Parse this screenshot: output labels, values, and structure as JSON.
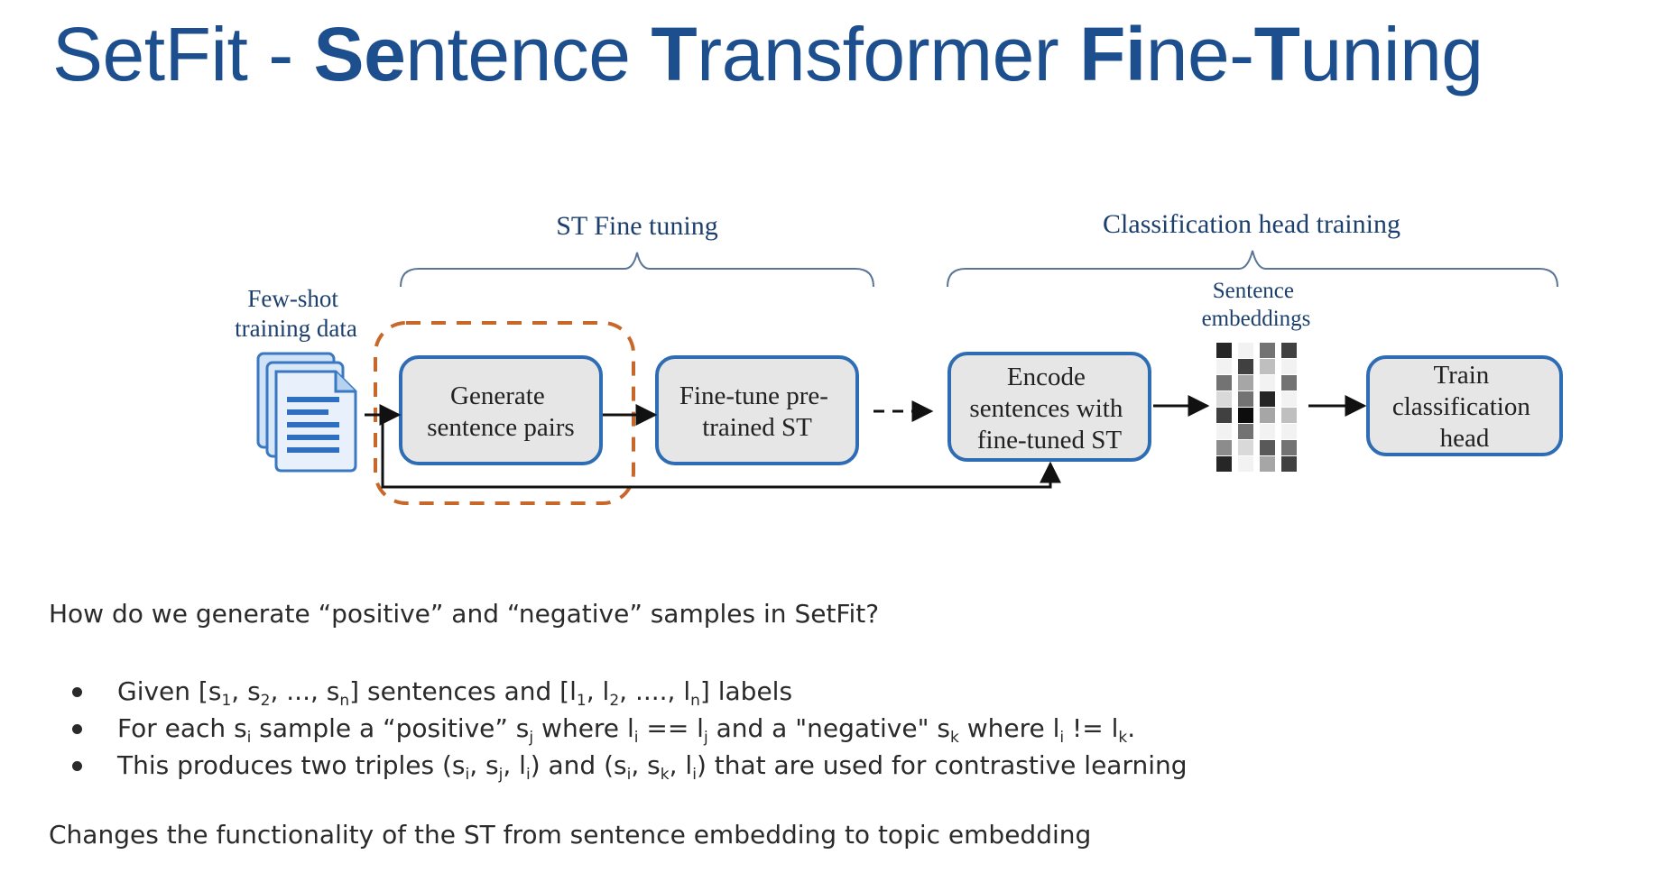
{
  "slide": {
    "title_parts": [
      {
        "t": "SetFit - ",
        "b": false
      },
      {
        "t": "Se",
        "b": true
      },
      {
        "t": "ntence ",
        "b": false
      },
      {
        "t": "T",
        "b": true
      },
      {
        "t": "ransformer ",
        "b": false
      },
      {
        "t": "Fi",
        "b": true
      },
      {
        "t": "ne-",
        "b": false
      },
      {
        "t": "T",
        "b": true
      },
      {
        "t": "uning",
        "b": false
      }
    ]
  },
  "diagram": {
    "stage_labels": {
      "st_fine_tuning": "ST Fine tuning",
      "classification_head_training": "Classification head training"
    },
    "input_label": [
      "Few-shot",
      "training data"
    ],
    "embeddings_label": [
      "Sentence",
      "embeddings"
    ],
    "boxes": {
      "generate": [
        "Generate",
        "sentence pairs"
      ],
      "finetune": [
        "Fine-tune pre-",
        "trained ST"
      ],
      "encode": [
        "Encode",
        "sentences with",
        "fine-tuned ST"
      ],
      "train": [
        "Train",
        "classification",
        "head"
      ]
    },
    "colors": {
      "box_border": "#2e6db4",
      "box_fill": "#e6e6e6",
      "highlight_dash": "#c8672a",
      "text": "#1c3f6e"
    },
    "embedding_matrix": [
      [
        0.85,
        0.05,
        0.55,
        0.75
      ],
      [
        0.05,
        0.75,
        0.25,
        0.05
      ],
      [
        0.55,
        0.35,
        0.05,
        0.55
      ],
      [
        0.15,
        0.55,
        0.85,
        0.05
      ],
      [
        0.75,
        0.95,
        0.35,
        0.25
      ],
      [
        0.05,
        0.55,
        0.05,
        0.05
      ],
      [
        0.45,
        0.15,
        0.65,
        0.55
      ],
      [
        0.85,
        0.05,
        0.35,
        0.75
      ]
    ]
  },
  "text": {
    "question": "How do we generate “positive” and “negative” samples in SetFit?",
    "bullets": [
      [
        [
          "t",
          "Given [s"
        ],
        [
          "s",
          "1"
        ],
        [
          "t",
          ", s"
        ],
        [
          "s",
          "2"
        ],
        [
          "t",
          ", ..., s"
        ],
        [
          "s",
          "n"
        ],
        [
          "t",
          "] sentences and [l"
        ],
        [
          "s",
          "1"
        ],
        [
          "t",
          ", l"
        ],
        [
          "s",
          "2"
        ],
        [
          "t",
          ", ...., l"
        ],
        [
          "s",
          "n"
        ],
        [
          "t",
          "] labels"
        ]
      ],
      [
        [
          "t",
          "For each s"
        ],
        [
          "s",
          "i"
        ],
        [
          "t",
          " sample a “positive” s"
        ],
        [
          "s",
          "j"
        ],
        [
          "t",
          " where l"
        ],
        [
          "s",
          "i"
        ],
        [
          "t",
          " == l"
        ],
        [
          "s",
          "j"
        ],
        [
          "t",
          " and a \"negative\" s"
        ],
        [
          "s",
          "k"
        ],
        [
          "t",
          " where l"
        ],
        [
          "s",
          "i"
        ],
        [
          "t",
          " != l"
        ],
        [
          "s",
          "k"
        ],
        [
          "t",
          "."
        ]
      ],
      [
        [
          "t",
          "This produces two triples (s"
        ],
        [
          "s",
          "i"
        ],
        [
          "t",
          ", s"
        ],
        [
          "s",
          "j"
        ],
        [
          "t",
          ", l"
        ],
        [
          "s",
          "i"
        ],
        [
          "t",
          ") and (s"
        ],
        [
          "s",
          "i"
        ],
        [
          "t",
          ", s"
        ],
        [
          "s",
          "k"
        ],
        [
          "t",
          ", l"
        ],
        [
          "s",
          "i"
        ],
        [
          "t",
          ") that are used for contrastive learning"
        ]
      ]
    ],
    "conclusion": "Changes the functionality of the ST from sentence embedding to topic embedding"
  }
}
